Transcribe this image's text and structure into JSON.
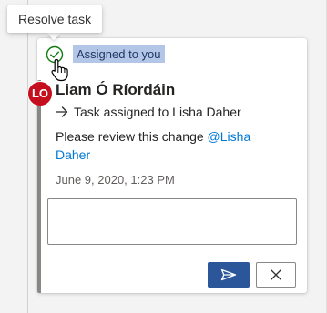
{
  "tooltip": {
    "text": "Resolve task"
  },
  "task": {
    "badge": "Assigned to you",
    "resolve_icon": "check-circle-icon"
  },
  "comment": {
    "avatar_initials": "LO",
    "avatar_color": "#c50f1f",
    "author": "Liam Ó Ríordáin",
    "assignment_text": "Task assigned to Lisha Daher",
    "body_prefix": "Please review this change ",
    "mention": "@Lisha Daher",
    "timestamp": "June 9, 2020, 1:23 PM"
  },
  "reply": {
    "input_value": "",
    "send_icon": "send-icon",
    "cancel_icon": "close-icon",
    "send_color": "#2b579a"
  }
}
